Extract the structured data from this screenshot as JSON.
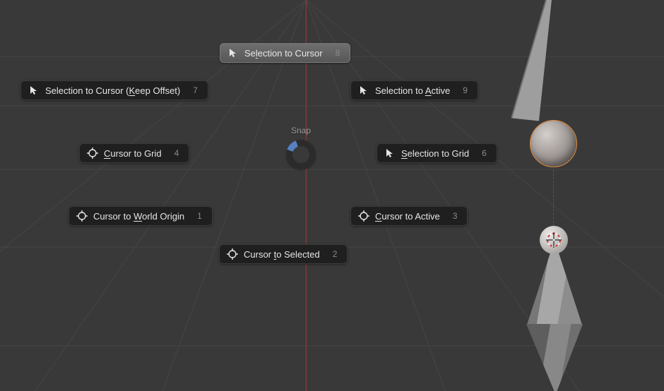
{
  "pie": {
    "title": "Snap",
    "items": {
      "selection_to_cursor": {
        "label": "Selection to Cursor",
        "shortcut": "8",
        "underline_index": 2,
        "icon": "cursor-arrow"
      },
      "selection_to_cursor_offset": {
        "label": "Selection to Cursor (Keep Offset)",
        "shortcut": "7",
        "underline_index": 21,
        "icon": "cursor-arrow"
      },
      "selection_to_active": {
        "label": "Selection to Active",
        "shortcut": "9",
        "underline_index": 13,
        "icon": "cursor-arrow"
      },
      "cursor_to_grid": {
        "label": "Cursor to Grid",
        "shortcut": "4",
        "underline_index": 0,
        "icon": "target"
      },
      "selection_to_grid": {
        "label": "Selection to Grid",
        "shortcut": "6",
        "underline_index": 0,
        "icon": "cursor-arrow"
      },
      "cursor_to_world_origin": {
        "label": "Cursor to World Origin",
        "shortcut": "1",
        "underline_index": 10,
        "icon": "target"
      },
      "cursor_to_active": {
        "label": "Cursor to Active",
        "shortcut": "3",
        "underline_index": 0,
        "icon": "target"
      },
      "cursor_to_selected": {
        "label": "Cursor to Selected",
        "shortcut": "2",
        "underline_index": 7,
        "icon": "target"
      }
    }
  },
  "scene": {
    "selected_object": "sphere",
    "selection_color": "#e38b3a"
  }
}
